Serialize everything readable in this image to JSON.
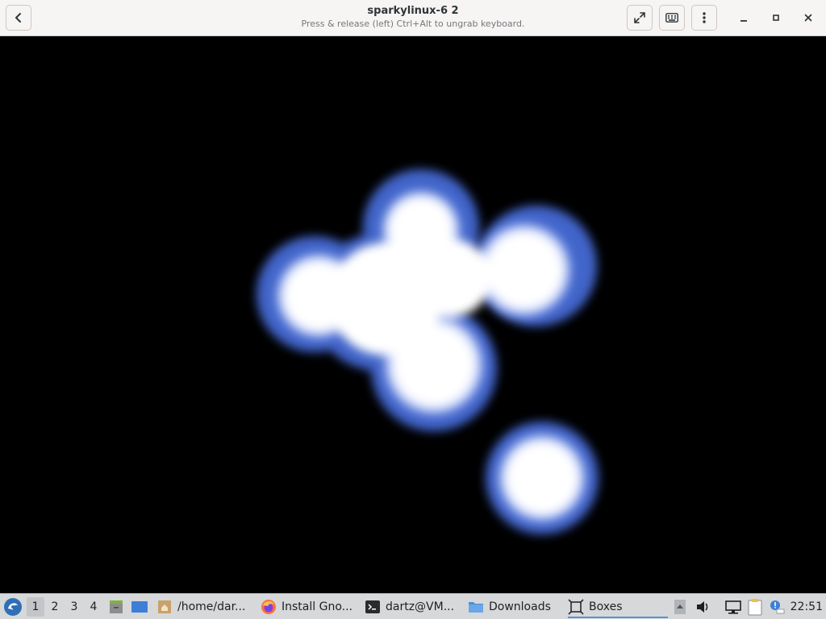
{
  "window": {
    "title": "sparkylinux-6 2",
    "subtitle": "Press & release (left) Ctrl+Alt to ungrab keyboard."
  },
  "headerbar": {
    "back_icon": "chevron-left-icon",
    "fullscreen_icon": "fullscreen-icon",
    "keyboard_icon": "keyboard-icon",
    "menu_icon": "vertical-ellipsis-icon",
    "minimize_icon": "minimize-icon",
    "maximize_icon": "maximize-icon",
    "close_icon": "close-icon"
  },
  "taskbar": {
    "workspaces": [
      "1",
      "2",
      "3",
      "4"
    ],
    "active_workspace": "1",
    "tasks": [
      {
        "label": "/home/dar...",
        "icon": "folder-home-icon"
      },
      {
        "label": "Install Gno...",
        "icon": "firefox-icon"
      },
      {
        "label": "dartz@VM...",
        "icon": "terminal-icon"
      },
      {
        "label": "Downloads",
        "icon": "folder-icon"
      },
      {
        "label": "Boxes",
        "icon": "boxes-icon"
      }
    ],
    "active_task": "Boxes",
    "clock": "22:51",
    "accent_color": "#5a91d6"
  }
}
